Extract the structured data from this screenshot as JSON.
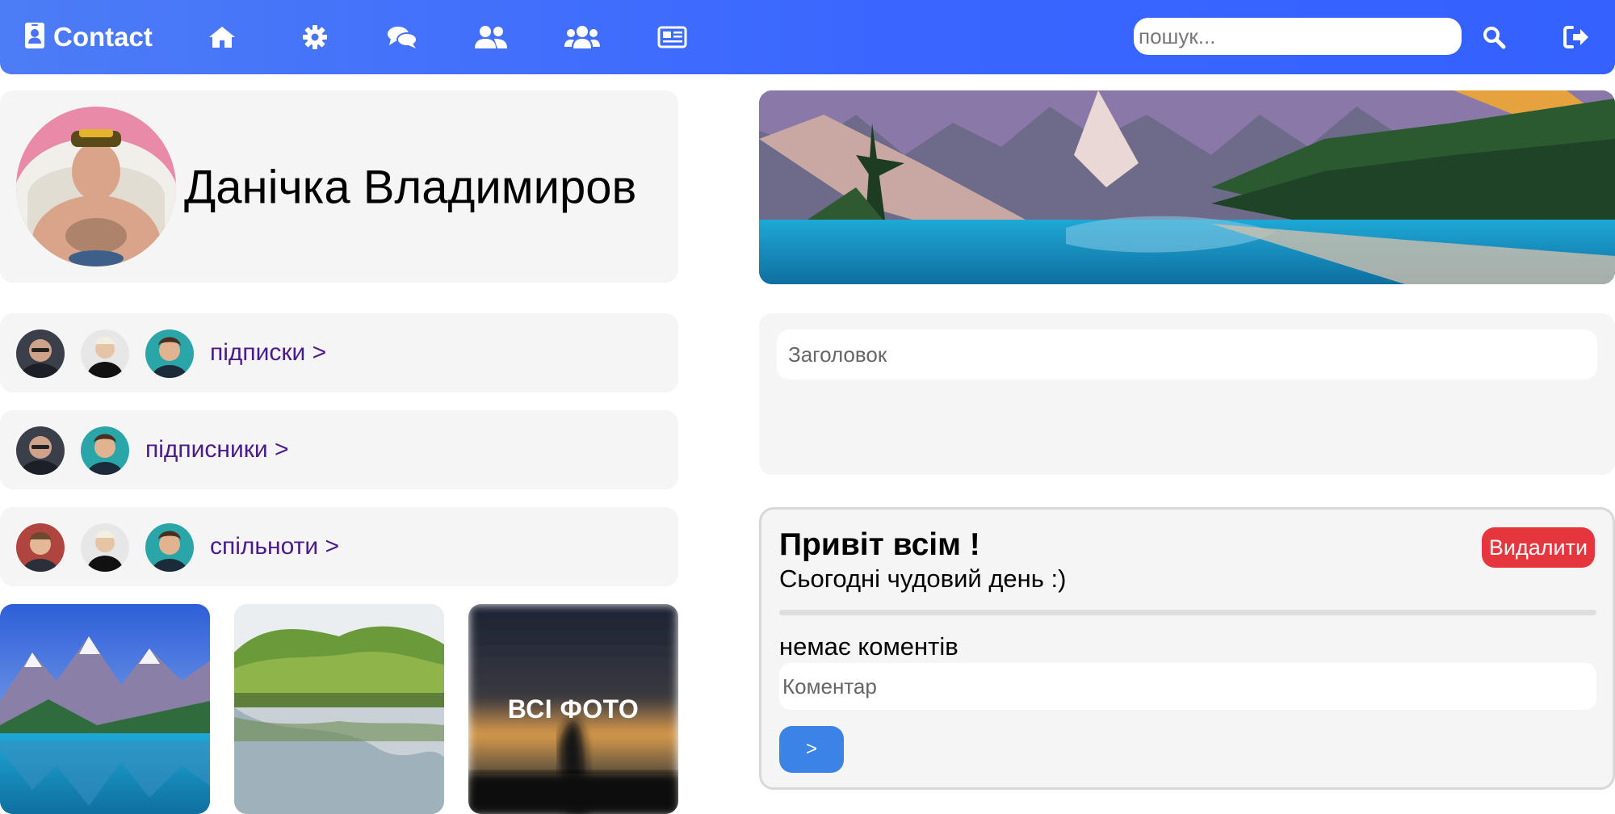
{
  "navbar": {
    "brand_icon": "contact-card-icon",
    "brand_title": "Contact",
    "icons": [
      "home-icon",
      "gear-icon",
      "chat-icon",
      "friends-icon",
      "groups-icon",
      "news-icon"
    ],
    "search_placeholder": "пошук...",
    "search_icon": "search-icon",
    "logout_icon": "logout-icon",
    "colors": {
      "gradient_start": "#4d7cf6",
      "gradient_end": "#3461ff"
    }
  },
  "profile": {
    "name": "Данічка Владимиров"
  },
  "rows": {
    "subscriptions": {
      "label": "підписки >"
    },
    "followers": {
      "label": "підписники >"
    },
    "communities": {
      "label": "спільноти >"
    }
  },
  "photos": {
    "all_label": "ВСІ ФОТО"
  },
  "post_form": {
    "title_placeholder": "Заголовок"
  },
  "post": {
    "title": "Привіт всім !",
    "body": "Сьогодні чудовий день :)",
    "delete_label": "Видалити",
    "no_comments": "немає коментів",
    "comment_placeholder": "Коментар",
    "send_label": ">"
  },
  "colors": {
    "panel_bg": "#f5f5f5",
    "link": "#4b1a8c",
    "delete": "#e5363d",
    "send": "#3b83e6"
  }
}
